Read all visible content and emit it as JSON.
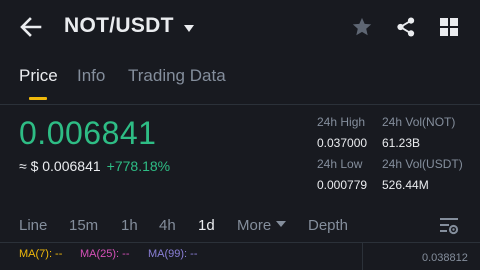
{
  "header": {
    "pair": "NOT/USDT",
    "icons": [
      "back-arrow-icon",
      "caret-down-icon",
      "star-icon",
      "share-icon",
      "grid-icon"
    ]
  },
  "tabs": [
    {
      "label": "Price",
      "active": true
    },
    {
      "label": "Info",
      "active": false
    },
    {
      "label": "Trading Data",
      "active": false
    }
  ],
  "price": {
    "last": "0.006841",
    "usd": "≈ $ 0.006841",
    "change": "+778.18%"
  },
  "stats": {
    "high_label": "24h High",
    "high_value": "0.037000",
    "vol_base_label": "24h Vol(NOT)",
    "vol_base_value": "61.23B",
    "low_label": "24h Low",
    "low_value": "0.000779",
    "vol_quote_label": "24h Vol(USDT)",
    "vol_quote_value": "526.44M"
  },
  "intervals": [
    "Line",
    "15m",
    "1h",
    "4h",
    "1d",
    "More",
    "Depth"
  ],
  "active_interval": "1d",
  "indicators": [
    {
      "label": "MA(7): --",
      "color": "#f0b90b"
    },
    {
      "label": "MA(25): --",
      "color": "#d650b8"
    },
    {
      "label": "MA(99): --",
      "color": "#8a7fd6"
    }
  ],
  "chart_axis_top": "0.038812",
  "colors": {
    "background": "#181a20",
    "accent": "#f0b90b",
    "positive": "#2ebd85",
    "muted": "#848e9c",
    "text": "#eaecef"
  }
}
